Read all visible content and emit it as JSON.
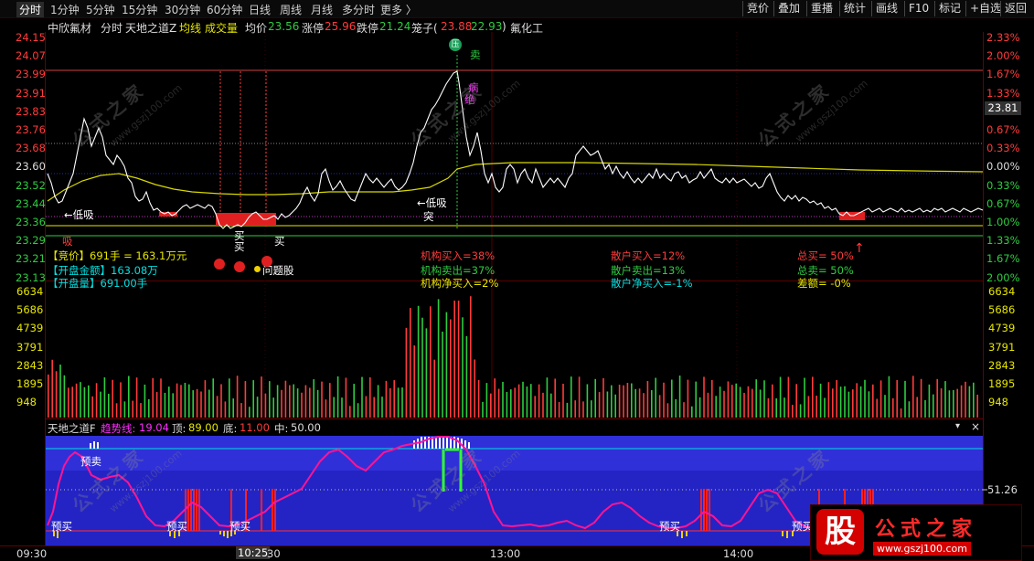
{
  "toolbar": {
    "tabs": [
      "分时",
      "1分钟",
      "5分钟",
      "15分钟",
      "30分钟",
      "60分钟",
      "日线",
      "周线",
      "月线",
      "多分时",
      "更多 〉"
    ],
    "right_buttons": [
      "竞价",
      "叠加",
      "重播",
      "统计",
      "画线",
      "F10",
      "+自选",
      "返回"
    ],
    "marker": "标记"
  },
  "info": {
    "stock_name": "中欣氟材",
    "mode": "分时",
    "indicator": "天地之道Z",
    "avg_line": "均线",
    "volume": "成交量",
    "avg_price_label": "均价",
    "avg_price": "23.56",
    "limit_up_label": "涨停",
    "limit_up": "25.96",
    "limit_down_label": "跌停",
    "limit_down": "21.24",
    "cage_label": "笼子(",
    "cage_a": "23.88",
    "cage_b": "22.93",
    "cage_close": ")",
    "sector": "氟化工"
  },
  "price_axis_left": [
    "24.15",
    "24.07",
    "23.99",
    "23.91",
    "23.83",
    "23.76",
    "23.68",
    "23.60",
    "23.52",
    "23.44",
    "23.36",
    "23.29",
    "23.21",
    "23.13"
  ],
  "pct_axis_right": [
    "2.33%",
    "2.00%",
    "1.67%",
    "1.33%",
    "1.00%",
    "0.67%",
    "0.33%",
    "0.00%",
    "0.33%",
    "0.67%",
    "1.00%",
    "1.33%",
    "1.67%",
    "2.00%"
  ],
  "price_pill": "23.81",
  "vol_axis": [
    "6634",
    "5686",
    "4739",
    "3791",
    "2843",
    "1895",
    "948"
  ],
  "time_axis": [
    "09:30",
    "10:25",
    "30",
    "13:00",
    "14:00"
  ],
  "chart_labels": {
    "dixi": "←低吸",
    "xi": "吸",
    "dixi2": "←低吸",
    "tu": "突",
    "mai1": "买",
    "mai2": "买",
    "mai3": "买",
    "sell": "卖",
    "top_circle": "压",
    "wenti": "问题股",
    "bing": "病",
    "jue": "绝"
  },
  "auction": {
    "price": "【竞价】691手 = 163.1万元",
    "amount": "【开盘金额】163.08万",
    "volume": "【开盘量】691.00手"
  },
  "stats": {
    "jigou_buy": "机构买入=38%",
    "jigou_sell": "机构卖出=37%",
    "jigou_net": "机构净买入=2%",
    "sanhu_buy": "散户买入=12%",
    "sanhu_sell": "散户卖出=13%",
    "sanhu_net": "散户净买入=-1%",
    "zong_buy": "总买= 50%",
    "zong_sell": "总卖= 50%",
    "cha": "差额= -0%"
  },
  "sub_panel": {
    "name": "天地之道F",
    "trend_label": "趋势线:",
    "trend": "19.04",
    "top_label": "顶:",
    "top": "89.00",
    "bottom_label": "底:",
    "bottom": "11.00",
    "mid_label": "中:",
    "mid": "50.00",
    "right_value": "51.26",
    "labels": [
      "预卖",
      "预买",
      "预买",
      "预买",
      "预买",
      "预买"
    ]
  },
  "watermark": {
    "cn": "公式之家",
    "url": "www.gszj100.com",
    "logo_char": "股",
    "logo_text": "公式之家",
    "logo_url": "www.gszj100.com"
  },
  "colors": {
    "up": "#ff3b3b",
    "down": "#2ecc40",
    "avg": "#e6e600",
    "price": "#ffffff",
    "trend": "#ff1493",
    "panel_bg": "#2020c8"
  }
}
